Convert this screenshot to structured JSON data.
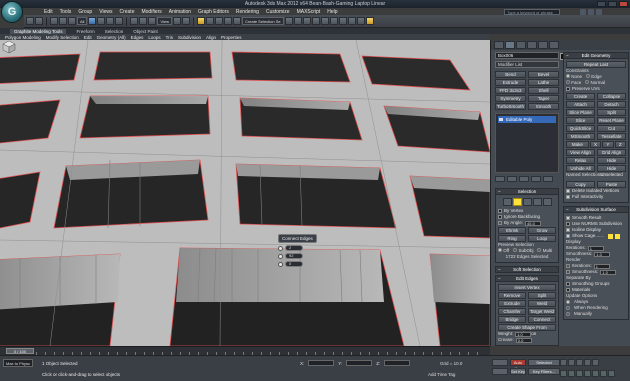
{
  "window": {
    "title": "Autodesk 3ds Max 2012 x64      Bean-Bash-Gaming Laptop Linear",
    "search_placeholder": "Type a keyword or phrase",
    "app_logo_letter": "G"
  },
  "menu": [
    "Edit",
    "Tools",
    "Group",
    "Views",
    "Create",
    "Modifiers",
    "Animation",
    "Graph Editors",
    "Rendering",
    "Customize",
    "MAXScript",
    "Help"
  ],
  "toolbar": {
    "selection_filter": "All",
    "ref_coord": "View",
    "named_selection": "Create Selection Se"
  },
  "ribbon": {
    "tabs": [
      "Graphite Modeling Tools",
      "Freeform",
      "Selection",
      "Object Paint"
    ],
    "active_tab": "Graphite Modeling Tools",
    "subtabs": [
      "Polygon Modeling",
      "Modify Selection",
      "Edit",
      "Geometry (All)",
      "Edges",
      "Loops",
      "Tris",
      "Subdivision",
      "Align",
      "Properties"
    ]
  },
  "viewport": {
    "caddy": {
      "title": "Connect Edges",
      "segments": "2",
      "pinch": "92",
      "slide": "0"
    }
  },
  "command_panel": {
    "object_name": "Box006",
    "modifier_list": "Modifier List",
    "modifier_buttons": [
      "Bend",
      "Bevel",
      "Extrude",
      "Lathe",
      "FFD 3x3x3",
      "Shell",
      "Symmetry",
      "Taper",
      "TurboSmooth",
      "Smooth"
    ],
    "stack": [
      "Editable Poly"
    ],
    "selection": {
      "header": "Selection",
      "by_vertex": "By Vertex",
      "ignore_backfacing": "Ignore Backfacing",
      "by_angle": "By Angle:",
      "by_angle_value": "45.0",
      "shrink": "Shrink",
      "grow": "Grow",
      "ring": "Ring",
      "loop": "Loop",
      "preview_label": "Preview Selection",
      "preview_options": [
        "Off",
        "SubObj",
        "Multi"
      ],
      "status": "1722 Edges Selected"
    },
    "soft_selection": {
      "header": "Soft Selection"
    },
    "edit_edges": {
      "header": "Edit Edges",
      "insert_vertex": "Insert Vertex",
      "remove": "Remove",
      "split": "Split",
      "extrude": "Extrude",
      "weld": "Weld",
      "chamfer": "Chamfer",
      "target_weld": "Target Weld",
      "bridge": "Bridge",
      "connect": "Connect",
      "create_shape": "Create Shape From Selection",
      "weight_label": "Weight:",
      "weight": "1.0",
      "crease_label": "Crease:",
      "crease": "0.0"
    },
    "edit_geometry": {
      "header": "Edit Geometry",
      "repeat_last": "Repeat Last",
      "constraints": "Constraints",
      "constraint_opts": [
        "None",
        "Edge",
        "Face",
        "Normal"
      ],
      "preserve_uvs": "Preserve UVs",
      "create": "Create",
      "collapse": "Collapse",
      "attach": "Attach",
      "detach": "Detach",
      "slice_plane": "Slice Plane",
      "split": "Split",
      "slice": "Slice",
      "reset_plane": "Reset Plane",
      "quickslice": "QuickSlice",
      "cut": "Cut",
      "msmooth": "MSmooth",
      "tessellate": "Tessellate",
      "make_planar": "Make Planar",
      "xyz": [
        "X",
        "Y",
        "Z"
      ],
      "view_align": "View Align",
      "grid_align": "Grid Align",
      "relax": "Relax",
      "hide_selected": "Hide Selected",
      "unhide_all": "Unhide All",
      "hide_unselected": "Hide Unselected",
      "named_selections": "Named Selections:",
      "copy": "Copy",
      "paste": "Paste",
      "delete_isolated": "Delete Isolated Vertices",
      "full_interactivity": "Full Interactivity"
    },
    "subdivision_surface": {
      "header": "Subdivision Surface",
      "smooth_result": "Smooth Result",
      "use_nurms": "Use NURMS Subdivision",
      "isoline": "Isoline Display",
      "show_cage": "Show Cage.......",
      "display": "Display",
      "iterations_label": "Iterations:",
      "iterations": "1",
      "smoothness_label": "Smoothness:",
      "smoothness": "1.0",
      "render": "Render",
      "separate_by": "Separate By",
      "smoothing_groups": "Smoothing Groups",
      "materials": "Materials",
      "update_options": "Update Options",
      "always": "Always",
      "when_rendering": "When Rendering",
      "manually": "Manually"
    }
  },
  "timeline": {
    "slider": "0 / 100"
  },
  "status": {
    "maxscript": "Max to Physc",
    "selection": "1 Object Selected",
    "hint": "Click or click-and-drag to select objects",
    "x_label": "X:",
    "y_label": "Y:",
    "z_label": "Z:",
    "grid": "Grid = 10.0",
    "add_time_tag": "Add Time Tag",
    "auto_key": "Auto Key",
    "set_key": "Set Key",
    "selected": "Selected",
    "key_filters": "Key Filters..."
  },
  "colors": {
    "accent_selection": "#ffe23a",
    "stack_highlight": "#3569b8",
    "edge_selected": "#d43a3a"
  }
}
